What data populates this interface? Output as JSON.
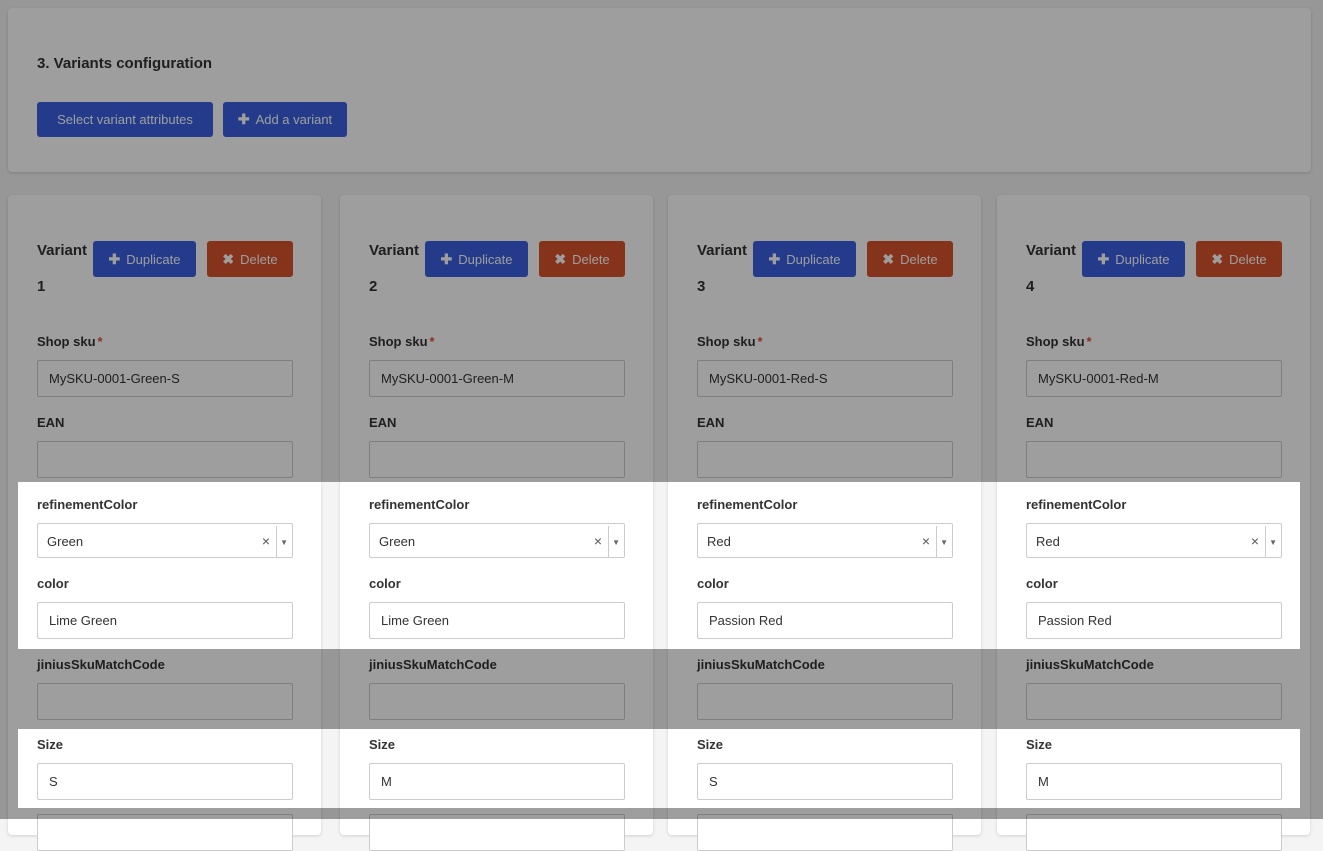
{
  "section": {
    "title": "3. Variants configuration",
    "select_attributes_label": "Select variant attributes",
    "add_variant_label": "Add a variant"
  },
  "labels": {
    "variant": "Variant",
    "duplicate": "Duplicate",
    "delete": "Delete",
    "shop_sku": "Shop sku",
    "required_mark": "*",
    "ean": "EAN",
    "refinement_color": "refinementColor",
    "color": "color",
    "jinius": "jiniusSkuMatchCode",
    "size": "Size"
  },
  "icons": {
    "plus": "plus-icon",
    "close": "close-icon",
    "clear": "clear-icon",
    "caret": "chevron-down-icon"
  },
  "colors": {
    "primary": "#3a5fe0",
    "danger": "#d9532c"
  },
  "variants": [
    {
      "number": "1",
      "shop_sku": "MySKU-0001-Green-S",
      "ean": "",
      "refinement_color": "Green",
      "color": "Lime Green",
      "jinius": "",
      "size": "S"
    },
    {
      "number": "2",
      "shop_sku": "MySKU-0001-Green-M",
      "ean": "",
      "refinement_color": "Green",
      "color": "Lime Green",
      "jinius": "",
      "size": "M"
    },
    {
      "number": "3",
      "shop_sku": "MySKU-0001-Red-S",
      "ean": "",
      "refinement_color": "Red",
      "color": "Passion Red",
      "jinius": "",
      "size": "S"
    },
    {
      "number": "4",
      "shop_sku": "MySKU-0001-Red-M",
      "ean": "",
      "refinement_color": "Red",
      "color": "Passion Red",
      "jinius": "",
      "size": "M"
    }
  ]
}
